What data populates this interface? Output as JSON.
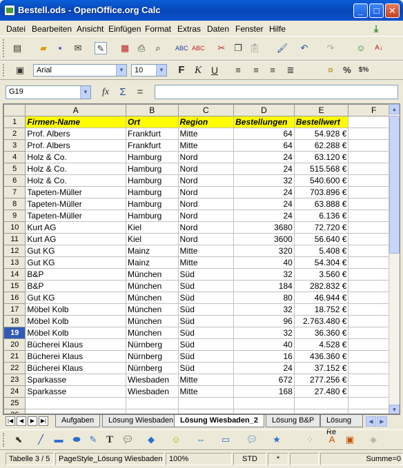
{
  "window": {
    "title": "Bestell.ods - OpenOffice.org Calc"
  },
  "menubar": {
    "items": [
      "Datei",
      "Bearbeiten",
      "Ansicht",
      "Einfügen",
      "Format",
      "Extras",
      "Daten",
      "Fenster",
      "Hilfe"
    ]
  },
  "format_toolbar": {
    "font_name": "Arial",
    "font_size": "10"
  },
  "formula_bar": {
    "cell_ref": "G19",
    "function_symbol": "fx",
    "sum_symbol": "Σ",
    "equals_symbol": "=",
    "value": ""
  },
  "columns": [
    "A",
    "B",
    "C",
    "D",
    "E",
    "F"
  ],
  "header_row": [
    "Firmen-Name",
    "Ort",
    "Region",
    "Bestellungen",
    "Bestellwert"
  ],
  "rows": [
    [
      "Prof. Albers",
      "Frankfurt",
      "Mitte",
      "64",
      "54.928 €"
    ],
    [
      "Prof. Albers",
      "Frankfurt",
      "Mitte",
      "64",
      "62.288 €"
    ],
    [
      "Holz & Co.",
      "Hamburg",
      "Nord",
      "24",
      "63.120 €"
    ],
    [
      "Holz & Co.",
      "Hamburg",
      "Nord",
      "24",
      "515.568 €"
    ],
    [
      "Holz & Co.",
      "Hamburg",
      "Nord",
      "32",
      "540.600 €"
    ],
    [
      "Tapeten-Müller",
      "Hamburg",
      "Nord",
      "24",
      "703.896 €"
    ],
    [
      "Tapeten-Müller",
      "Hamburg",
      "Nord",
      "24",
      "63.888 €"
    ],
    [
      "Tapeten-Müller",
      "Hamburg",
      "Nord",
      "24",
      "6.136 €"
    ],
    [
      "Kurt AG",
      "Kiel",
      "Nord",
      "3680",
      "72.720 €"
    ],
    [
      "Kurt AG",
      "Kiel",
      "Nord",
      "3600",
      "56.640 €"
    ],
    [
      "Gut KG",
      "Mainz",
      "Mitte",
      "320",
      "5.408 €"
    ],
    [
      "Gut KG",
      "Mainz",
      "Mitte",
      "40",
      "54.304 €"
    ],
    [
      "B&P",
      "München",
      "Süd",
      "32",
      "3.560 €"
    ],
    [
      "B&P",
      "München",
      "Süd",
      "184",
      "282.832 €"
    ],
    [
      "Gut KG",
      "München",
      "Süd",
      "80",
      "46.944 €"
    ],
    [
      "Möbel Kolb",
      "München",
      "Süd",
      "32",
      "18.752 €"
    ],
    [
      "Möbel Kolb",
      "München",
      "Süd",
      "96",
      "2.763.480 €"
    ],
    [
      "Möbel Kolb",
      "München",
      "Süd",
      "32",
      "36.360 €"
    ],
    [
      "Bücherei Klaus",
      "Nürnberg",
      "Süd",
      "40",
      "4.528 €"
    ],
    [
      "Bücherei Klaus",
      "Nürnberg",
      "Süd",
      "16",
      "436.360 €"
    ],
    [
      "Bücherei Klaus",
      "Nürnberg",
      "Süd",
      "24",
      "37.152 €"
    ],
    [
      "Sparkasse",
      "Wiesbaden",
      "Mitte",
      "672",
      "277.256 €"
    ],
    [
      "Sparkasse",
      "Wiesbaden",
      "Mitte",
      "168",
      "27.480 €"
    ],
    [
      "",
      "",
      "",
      "",
      ""
    ],
    [
      "",
      "",
      "",
      "",
      ""
    ]
  ],
  "active_row": "19",
  "sheet_tabs": [
    {
      "label": "Aufgaben",
      "active": false
    },
    {
      "label": "Lösung Wiesbaden",
      "active": false
    },
    {
      "label": "Lösung Wiesbaden_2",
      "active": true
    },
    {
      "label": "Lösung B&P",
      "active": false
    },
    {
      "label": "Lösung Re",
      "active": false
    }
  ],
  "statusbar": {
    "sheet": "Tabelle 3 / 5",
    "page_style": "PageStyle_Lösung Wiesbaden",
    "zoom": "100%",
    "mode": "STD",
    "modified": "*",
    "sum": "Summe=0"
  },
  "colors": {
    "title_bar": "#0a5fd8",
    "header_fill": "#ffff00",
    "active_row_header": "#2f5bb7"
  }
}
